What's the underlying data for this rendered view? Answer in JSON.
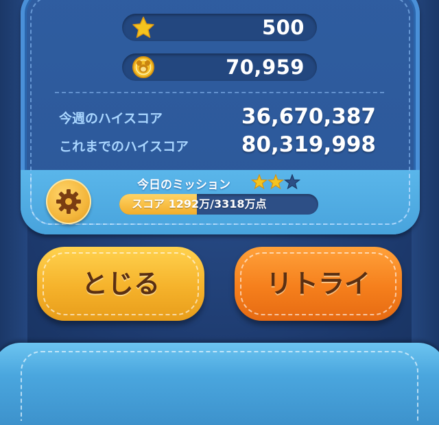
{
  "results": {
    "stars": "500",
    "coins": "70,959"
  },
  "scores": {
    "weekly_label": "今週のハイスコア",
    "weekly_value": "36,670,387",
    "alltime_label": "これまでのハイスコア",
    "alltime_value": "80,319,998"
  },
  "mission": {
    "title": "今日のミッション",
    "stars_earned": 2,
    "stars_total": 3,
    "progress_text": "スコア 1292万/3318万点",
    "progress_fraction": 0.389
  },
  "buttons": {
    "close_label": "とじる",
    "retry_label": "リトライ"
  },
  "icons": {
    "star": "star-icon",
    "coin": "coin-icon",
    "settings": "gear-icon"
  },
  "colors": {
    "panel": "#2f5da0",
    "panel_bottom": "#5ab6ea",
    "close_button": "#f5b22b",
    "retry_button": "#f57f1c",
    "star": "#f5c41f",
    "star_empty": "#2d4f86"
  }
}
